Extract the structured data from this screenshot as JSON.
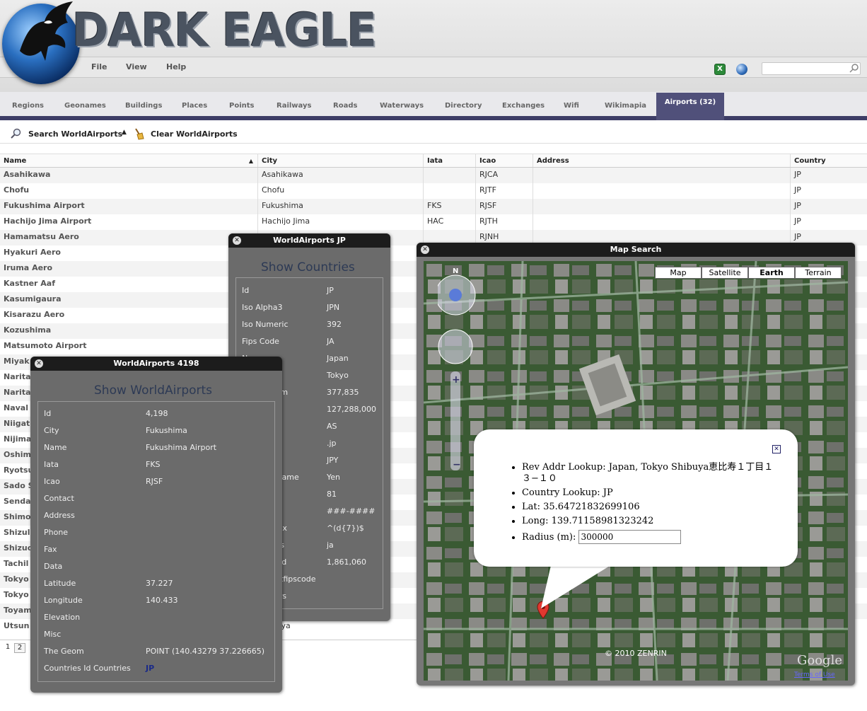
{
  "app": {
    "logo_text": "DARK EAGLE"
  },
  "menu": [
    "File",
    "View",
    "Help"
  ],
  "header_icons": [
    "excel-icon",
    "globe-icon"
  ],
  "search": {
    "placeholder": ""
  },
  "tabs": [
    "Regions",
    "Geonames",
    "Buildings",
    "Places",
    "Points",
    "Railways",
    "Roads",
    "Waterways",
    "Directory",
    "Exchanges",
    "Wifi",
    "Wikimapia"
  ],
  "active_tab": "Airports (32)",
  "toolbar": {
    "search_label": "Search WorldAirports",
    "clear_label": "Clear WorldAirports"
  },
  "grid": {
    "columns": [
      "Name",
      "City",
      "Iata",
      "Icao",
      "Address",
      "Country"
    ],
    "sort_indicator": "▲",
    "rows": [
      [
        "Asahikawa",
        "Asahikawa",
        "",
        "RJCA",
        "",
        "JP"
      ],
      [
        "Chofu",
        "Chofu",
        "",
        "RJTF",
        "",
        "JP"
      ],
      [
        "Fukushima Airport",
        "Fukushima",
        "FKS",
        "RJSF",
        "",
        "JP"
      ],
      [
        "Hachijo Jima Airport",
        "Hachijo Jima",
        "HAC",
        "RJTH",
        "",
        "JP"
      ],
      [
        "Hamamatsu Aero",
        "",
        "",
        "RJNH",
        "",
        "JP"
      ],
      [
        "Hyakuri Aero",
        "",
        "",
        "RJAH",
        "",
        "JP"
      ],
      [
        "Iruma Aero",
        "",
        "",
        "",
        "",
        ""
      ],
      [
        "Kastner Aaf",
        "",
        "",
        "",
        "",
        ""
      ],
      [
        "Kasumigaura",
        "",
        "",
        "",
        "",
        ""
      ],
      [
        "Kisarazu Aero",
        "",
        "",
        "",
        "",
        ""
      ],
      [
        "Kozushima",
        "",
        "",
        "",
        "",
        ""
      ],
      [
        "Matsumoto Airport",
        "",
        "",
        "",
        "",
        ""
      ],
      [
        "Miyak",
        "",
        "",
        "",
        "",
        ""
      ],
      [
        "Narita",
        "",
        "",
        "",
        "",
        ""
      ],
      [
        "Narita",
        "",
        "",
        "",
        "",
        ""
      ],
      [
        "Naval",
        "",
        "",
        "",
        "",
        ""
      ],
      [
        "Niigat",
        "",
        "",
        "",
        "",
        ""
      ],
      [
        "Nijima",
        "",
        "",
        "",
        "",
        ""
      ],
      [
        "Oshim",
        "",
        "",
        "",
        "",
        ""
      ],
      [
        "Ryotsu",
        "",
        "",
        "",
        "",
        ""
      ],
      [
        "Sado S",
        "",
        "",
        "",
        "",
        ""
      ],
      [
        "Senda",
        "",
        "",
        "",
        "",
        ""
      ],
      [
        "Shimo",
        "",
        "",
        "",
        "",
        ""
      ],
      [
        "Shizul",
        "",
        "",
        "",
        "",
        ""
      ],
      [
        "Shizuo",
        "",
        "",
        "",
        "",
        ""
      ],
      [
        "Tachil",
        "",
        "",
        "",
        "",
        ""
      ],
      [
        "Tokyo",
        "",
        "",
        "",
        "",
        ""
      ],
      [
        "Tokyo",
        "",
        "",
        "",
        "",
        ""
      ],
      [
        "Toyam",
        "",
        "",
        "",
        "",
        ""
      ],
      [
        "Utsun",
        "nomiya",
        "",
        "",
        "",
        ""
      ]
    ]
  },
  "pager": {
    "pages": [
      "1",
      "2"
    ]
  },
  "win_airport": {
    "title": "WorldAirports 4198",
    "subtitle": "Show WorldAirports",
    "fields": [
      [
        "Id",
        "4,198"
      ],
      [
        "City",
        "Fukushima"
      ],
      [
        "Name",
        "Fukushima Airport"
      ],
      [
        "Iata",
        "FKS"
      ],
      [
        "Icao",
        "RJSF"
      ],
      [
        "Contact",
        ""
      ],
      [
        "Address",
        ""
      ],
      [
        "Phone",
        ""
      ],
      [
        "Fax",
        ""
      ],
      [
        "Data",
        ""
      ],
      [
        "Latitude",
        "37.227"
      ],
      [
        "Longitude",
        "140.433"
      ],
      [
        "Elevation",
        ""
      ],
      [
        "Misc",
        ""
      ],
      [
        "The Geom",
        "POINT (140.43279 37.226665)"
      ],
      [
        "Countries Id Countries",
        "JP"
      ]
    ]
  },
  "win_country": {
    "title": "WorldAirports JP",
    "subtitle": "Show Countries",
    "fields": [
      [
        "Id",
        "JP"
      ],
      [
        "Iso Alpha3",
        "JPN"
      ],
      [
        "Iso Numeric",
        "392"
      ],
      [
        "Fips Code",
        "JA"
      ],
      [
        "Name",
        "Japan"
      ],
      [
        "Capital",
        "Tokyo"
      ],
      [
        "Areainsqkm",
        "377,835"
      ],
      [
        "Population",
        "127,288,000"
      ],
      [
        "Continent",
        "AS"
      ],
      [
        "Tld",
        ".jp"
      ],
      [
        "Currency",
        "JPY"
      ],
      [
        "Currencyname",
        "Yen"
      ],
      [
        "Phone",
        "81"
      ],
      [
        "Postal",
        "###-####"
      ],
      [
        "Postalregex",
        "^(d{7})$"
      ],
      [
        "Languages",
        "ja"
      ],
      [
        "Geonameid",
        "1,861,060"
      ],
      [
        "Equivalentfipscode",
        ""
      ],
      [
        "Neighbours",
        ""
      ]
    ]
  },
  "win_map": {
    "title": "Map Search",
    "map_types": [
      "Map",
      "Satellite",
      "Earth",
      "Terrain"
    ],
    "selected_map_type": "Earth",
    "compass": "N",
    "copyright": "© 2010 ZENRIN",
    "google": "Google",
    "terms": "Terms of Use",
    "popup": {
      "rev_addr": "Rev Addr Lookup: Japan, Tokyo Shibuya恵比寿１丁目１３−１０",
      "country": "Country Lookup: JP",
      "lat": "Lat: 35.64721832699106",
      "long": "Long: 139.71158981323242",
      "radius_label": "Radius (m):",
      "radius_value": "300000"
    }
  }
}
